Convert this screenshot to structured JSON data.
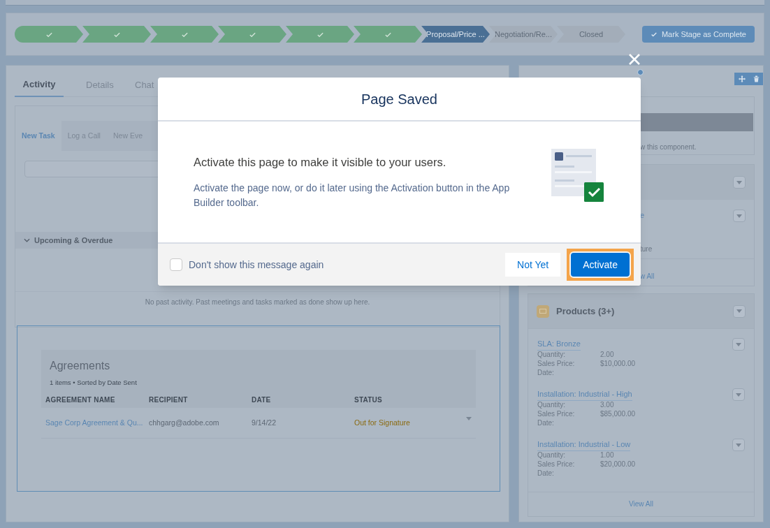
{
  "path": {
    "steps": [
      {
        "completed": true,
        "current": false
      },
      {
        "completed": true,
        "current": false
      },
      {
        "completed": true,
        "current": false
      },
      {
        "completed": true,
        "current": false
      },
      {
        "completed": true,
        "current": false
      },
      {
        "completed": true,
        "current": false
      },
      {
        "label": "Proposal/Price ...",
        "completed": false,
        "current": true
      },
      {
        "label": "Negotiation/Re...",
        "completed": false,
        "current": false
      },
      {
        "label": "Closed",
        "completed": false,
        "current": false
      }
    ],
    "complete_button": "Mark Stage as Complete"
  },
  "activity": {
    "tabs": [
      {
        "label": "Activity",
        "selected": true
      },
      {
        "label": "Details",
        "selected": false
      },
      {
        "label": "Chat",
        "selected": false
      }
    ],
    "composer_tabs": [
      {
        "label": "New Task",
        "selected": true
      },
      {
        "label": "Log a Call",
        "selected": false
      },
      {
        "label": "New Eve",
        "selected": false
      }
    ],
    "upcoming": {
      "label": "Upcoming & Overdue",
      "expanded": true
    },
    "empty_message": "No past activity. Past meetings and tasks marked as done show up here."
  },
  "agreements": {
    "title": "Agreements",
    "subtitle": "1 items • Sorted by Date Sent",
    "columns": [
      "AGREEMENT NAME",
      "RECIPIENT",
      "DATE",
      "STATUS"
    ],
    "rows": [
      [
        "Sage Corp Agreement & Qu...",
        "chhgarg@adobe.com",
        "9/14/22",
        "Out for Signature"
      ]
    ]
  },
  "sidebar": {
    "notice_fragment": "w this component.",
    "item_fragment": "e",
    "item_fragment_2": "ture",
    "view_all_fragment": "w All",
    "products": {
      "title": "Products (3+)",
      "items": [
        {
          "name": "SLA: Bronze",
          "fields": [
            {
              "label": "Quantity:",
              "value": "2.00"
            },
            {
              "label": "Sales Price:",
              "value": "$10,000.00"
            },
            {
              "label": "Date:"
            }
          ]
        },
        {
          "name": "Installation: Industrial - High",
          "fields": [
            {
              "label": "Quantity:",
              "value": "3.00"
            },
            {
              "label": "Sales Price:",
              "value": "$85,000.00"
            },
            {
              "label": "Date:"
            }
          ]
        },
        {
          "name": "Installation: Industrial - Low",
          "fields": [
            {
              "label": "Quantity:",
              "value": "1.00"
            },
            {
              "label": "Sales Price:",
              "value": "$20,000.00"
            },
            {
              "label": "Date:"
            }
          ]
        }
      ],
      "view_all": "View All"
    }
  },
  "modal": {
    "title": "Page Saved",
    "headline": "Activate this page to make it visible to your users.",
    "body": "Activate the page now, or do it later using the Activation button in the App Builder toolbar.",
    "checkbox": {
      "label": "Don't show this message again",
      "checked": false
    },
    "buttons": [
      {
        "label": "Not Yet",
        "kind": "neutral",
        "focused": false
      },
      {
        "label": "Activate",
        "kind": "brand",
        "focused": true
      }
    ]
  }
}
